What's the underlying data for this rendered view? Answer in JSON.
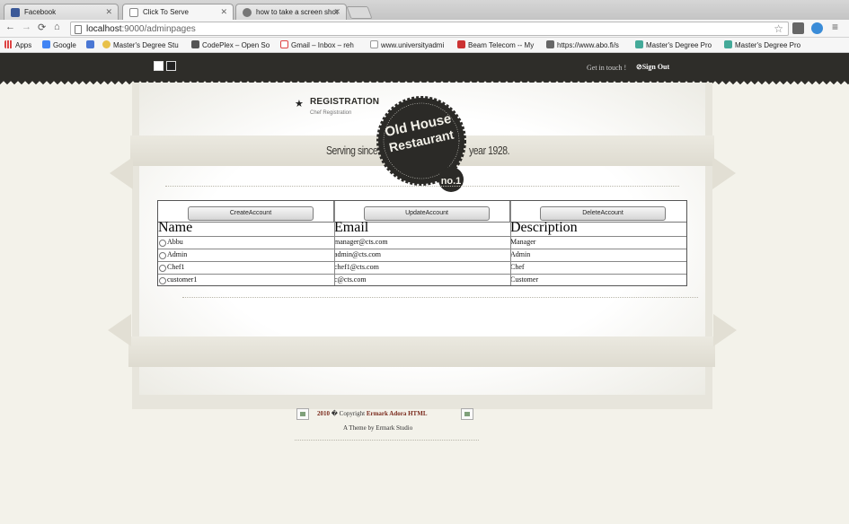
{
  "browser": {
    "tabs": [
      {
        "title": "Facebook",
        "icon": "facebook-icon",
        "color": "#3b5998"
      },
      {
        "title": "Click To Serve",
        "icon": "page-icon",
        "color": "#888888"
      },
      {
        "title": "how to take a screen shot",
        "icon": "apple-icon",
        "color": "#666666"
      }
    ],
    "url_host": "localhost",
    "url_port": ":9000",
    "url_path": "/adminpages",
    "bookmarks": [
      {
        "label": "Apps",
        "color": "#d44"
      },
      {
        "label": "Google",
        "color": "#4285f4"
      },
      {
        "label": "",
        "color": "#4a77d4"
      },
      {
        "label": "Master's Degree Stu",
        "color": "#e8c14a"
      },
      {
        "label": "CodePlex – Open So",
        "color": "#555"
      },
      {
        "label": "Gmail – Inbox – reh",
        "color": "#d44"
      },
      {
        "label": "www.universityadmi",
        "color": "#aaa"
      },
      {
        "label": "Beam Telecom -- My",
        "color": "#c33"
      },
      {
        "label": "https://www.abo.fi/s",
        "color": "#666"
      },
      {
        "label": "Master's Degree Pro",
        "color": "#4a9"
      },
      {
        "label": "Master's Degree Pro",
        "color": "#4a9"
      }
    ]
  },
  "site": {
    "get_in_touch": "Get in touch !",
    "sign_out": "Sign Out",
    "registration_title": "REGISTRATION",
    "registration_sub": "Chef Registration",
    "serving_since": "Serving since",
    "year": "year 1928.",
    "badge_line1": "Old House",
    "badge_line2": "Restaurant",
    "badge_line3": "no.1"
  },
  "actions": {
    "create": "CreateAccount",
    "update": "UpdateAccount",
    "delete": "DeleteAccount"
  },
  "table": {
    "headers": [
      "Name",
      "Email",
      "Description"
    ],
    "rows": [
      {
        "name": "Abbu",
        "email": "manager@cts.com",
        "description": "Manager"
      },
      {
        "name": "Admin",
        "email": "admin@cts.com",
        "description": "Admin"
      },
      {
        "name": "Chef1",
        "email": "chef1@cts.com",
        "description": "Chef"
      },
      {
        "name": "customer1",
        "email": "c@cts.com",
        "description": "Customer"
      }
    ]
  },
  "footer": {
    "year": "2010",
    "copyright": "� Copyright",
    "brand": "Ermark Adora HTML",
    "theme": "A Theme by Ermark Studio"
  },
  "colors": {
    "site_bar": "#2e2d29",
    "page_bg": "#f3f2ea",
    "footer_accent": "#7a2a1c"
  }
}
